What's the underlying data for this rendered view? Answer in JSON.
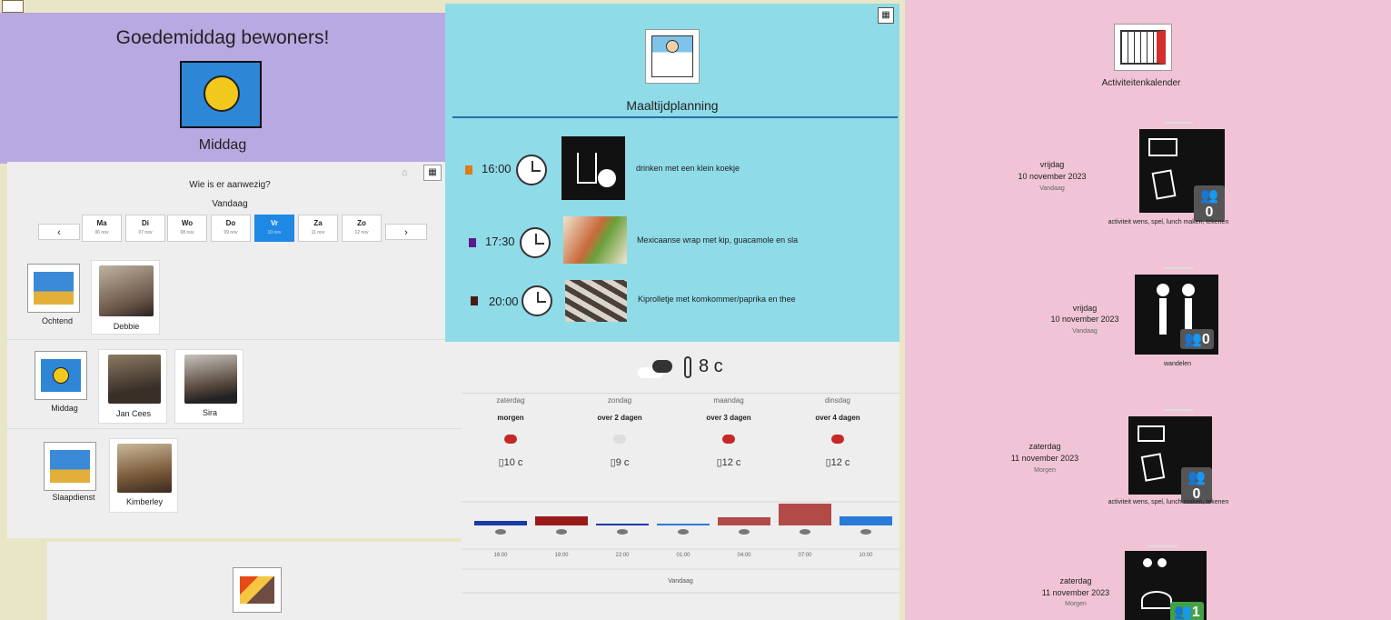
{
  "greeting": {
    "title": "Goedemiddag bewoners!",
    "part_of_day": "Middag",
    "bg": "#b9a9e2"
  },
  "presence": {
    "question": "Wie is er aanwezig?",
    "today_label": "Vandaag",
    "days": [
      {
        "d": "Ma",
        "s": "06 nov"
      },
      {
        "d": "Di",
        "s": "07 nov"
      },
      {
        "d": "Wo",
        "s": "08 nov"
      },
      {
        "d": "Do",
        "s": "09 nov"
      },
      {
        "d": "Vr",
        "s": "10 nov"
      },
      {
        "d": "Za",
        "s": "11 nov"
      },
      {
        "d": "Zo",
        "s": "12 nov"
      }
    ],
    "prev": "‹",
    "next": "›",
    "shifts": [
      {
        "label": "Ochtend",
        "people": [
          "Debbie"
        ]
      },
      {
        "label": "Middag",
        "people": [
          "Jan Cees",
          "Sira"
        ]
      },
      {
        "label": "Slaapdienst",
        "people": [
          "Kimberley"
        ]
      }
    ]
  },
  "meals": {
    "title": "Maaltijdplanning",
    "bg": "#8fdbe8",
    "items": [
      {
        "time": "16:00",
        "text": "drinken met een klein koekje",
        "color": "#e07b1a"
      },
      {
        "time": "17:30",
        "text": "Mexicaanse wrap met kip, guacamole en sla",
        "color": "#5a1a8a"
      },
      {
        "time": "20:00",
        "text": "Kiprolletje met komkommer/paprika en thee",
        "color": "#4a1a14"
      }
    ]
  },
  "weather": {
    "current": "8 c",
    "days": [
      {
        "name": "zaterdag",
        "rel": "morgen",
        "temp": "10 c"
      },
      {
        "name": "zondag",
        "rel": "over 2 dagen",
        "temp": "9 c"
      },
      {
        "name": "maandag",
        "rel": "over 3 dagen",
        "temp": "12 c"
      },
      {
        "name": "dinsdag",
        "rel": "over 4 dagen",
        "temp": "12 c"
      }
    ],
    "hours": [
      "16:00",
      "19:00",
      "22:00",
      "01:00",
      "04:00",
      "07:00",
      "10:00"
    ],
    "footer": "Vandaag"
  },
  "activities": {
    "title": "Activiteitenkalender",
    "bg": "#f0c4d6",
    "items": [
      {
        "day": "vrijdag",
        "date": "10 november 2023",
        "rel": "Vandaag",
        "caption": "activiteit wens, spel, lunch maken, tekenen",
        "count": "0"
      },
      {
        "day": "vrijdag",
        "date": "10 november 2023",
        "rel": "Vandaag",
        "caption": "wandelen",
        "count": "0"
      },
      {
        "day": "zaterdag",
        "date": "11 november 2023",
        "rel": "Morgen",
        "caption": "activiteit wens, spel, lunch maken, tekenen",
        "count": "0"
      },
      {
        "day": "zaterdag",
        "date": "11 november 2023",
        "rel": "Morgen",
        "caption": "",
        "count": "1"
      }
    ]
  }
}
